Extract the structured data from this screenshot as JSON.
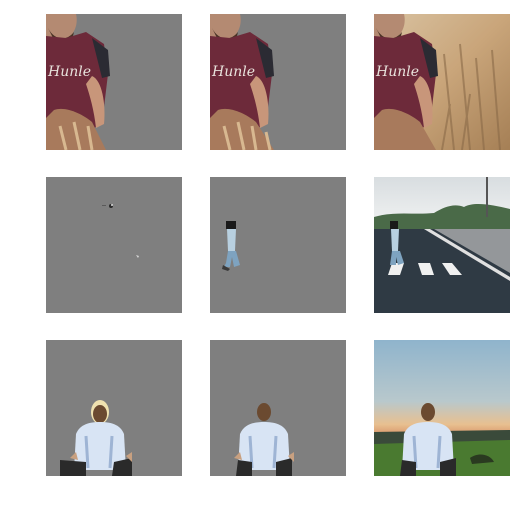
{
  "grid": {
    "rows": 3,
    "columns": 3,
    "colors": {
      "mask_background": "#7f7f7f",
      "page_background": "#ffffff"
    },
    "tiles": [
      {
        "row": 1,
        "col": 1,
        "kind": "segmentation-mask",
        "subject": "man in maroon t-shirt (cropped)"
      },
      {
        "row": 1,
        "col": 2,
        "kind": "segmentation-mask",
        "subject": "man in maroon t-shirt (cropped)"
      },
      {
        "row": 1,
        "col": 3,
        "kind": "original-photo",
        "subject": "man in maroon t-shirt in wheat field"
      },
      {
        "row": 2,
        "col": 1,
        "kind": "segmentation-mask",
        "subject": "sparse fragments"
      },
      {
        "row": 2,
        "col": 2,
        "kind": "segmentation-mask",
        "subject": "person crossing street"
      },
      {
        "row": 2,
        "col": 3,
        "kind": "original-photo",
        "subject": "person crossing a street at crosswalk"
      },
      {
        "row": 3,
        "col": 1,
        "kind": "segmentation-mask",
        "subject": "seated person from behind"
      },
      {
        "row": 3,
        "col": 2,
        "kind": "segmentation-mask",
        "subject": "seated person from behind"
      },
      {
        "row": 3,
        "col": 3,
        "kind": "original-photo",
        "subject": "person meditating at sunset"
      }
    ],
    "shirt_text": "Hunle"
  }
}
